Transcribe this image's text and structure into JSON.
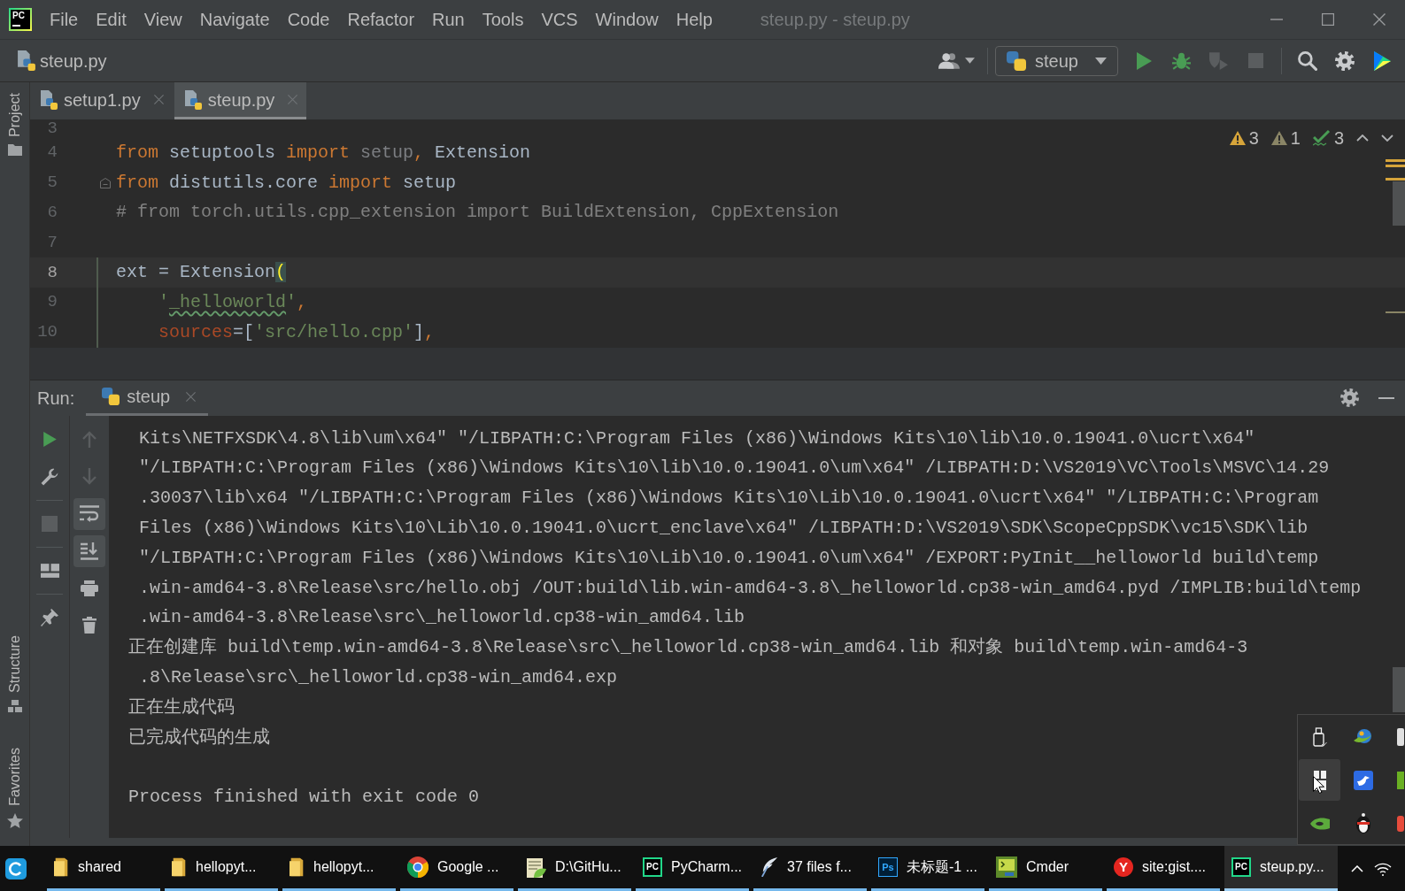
{
  "window": {
    "logo": "PC",
    "title": "steup.py - steup.py"
  },
  "menu": [
    {
      "label": "File"
    },
    {
      "label": "Edit"
    },
    {
      "label": "View"
    },
    {
      "label": "Navigate"
    },
    {
      "label": "Code"
    },
    {
      "label": "Refactor"
    },
    {
      "label": "Run"
    },
    {
      "label": "Tools"
    },
    {
      "label": "VCS"
    },
    {
      "label": "Window"
    },
    {
      "label": "Help"
    }
  ],
  "navigation_bar": {
    "breadcrumb": "steup.py",
    "run_configuration": "steup",
    "actions": [
      {
        "disabled": false
      },
      {
        "disabled": false
      },
      {
        "disabled": true
      },
      {
        "disabled": true
      }
    ]
  },
  "tool_strip": {
    "top": [
      {
        "label": "Project",
        "kind": "folder"
      }
    ],
    "bottom": [
      {
        "label": "Structure",
        "kind": "tree"
      },
      {
        "label": "Favorites",
        "kind": "star"
      }
    ]
  },
  "editor_tabs": [
    {
      "label": "setup1.py",
      "selected": false
    },
    {
      "label": "steup.py",
      "selected": true
    }
  ],
  "editor": {
    "inspections": [
      {
        "kind": "warning",
        "count": "3"
      },
      {
        "kind": "weak",
        "count": "1"
      },
      {
        "kind": "typo",
        "count": "3"
      }
    ],
    "lines": [
      {
        "number": "3",
        "current": false,
        "changed": false,
        "fold": false
      },
      {
        "number": "4",
        "current": false,
        "changed": false,
        "fold": false,
        "indented": false,
        "tokens": [
          {
            "text": "from",
            "kind": "keyword"
          },
          {
            "text": " setuptools ",
            "kind": "plain"
          },
          {
            "text": "import",
            "kind": "keyword"
          },
          {
            "text": " setup",
            "kind": "unused"
          },
          {
            "text": ",",
            "kind": "punct"
          },
          {
            "text": " Extension",
            "kind": "plain"
          }
        ]
      },
      {
        "number": "5",
        "current": false,
        "changed": false,
        "fold": true,
        "indented": false,
        "tokens": [
          {
            "text": "from",
            "kind": "keyword"
          },
          {
            "text": " distutils.core ",
            "kind": "plain"
          },
          {
            "text": "import",
            "kind": "keyword"
          },
          {
            "text": " setup",
            "kind": "plain"
          }
        ]
      },
      {
        "number": "6",
        "current": false,
        "changed": false,
        "fold": false,
        "indented": false,
        "tokens": [
          {
            "text": "# from torch.utils.cpp_extension import BuildExtension, CppExtension",
            "kind": "comment"
          }
        ]
      },
      {
        "number": "7",
        "current": false,
        "changed": false,
        "fold": false
      },
      {
        "number": "8",
        "current": true,
        "changed": true,
        "fold": false,
        "indented": false,
        "tokens": [
          {
            "text": "ext = Extension",
            "kind": "plain"
          },
          {
            "text": "(",
            "kind": "match"
          }
        ]
      },
      {
        "number": "9",
        "current": false,
        "changed": true,
        "fold": false,
        "indented": true,
        "tokens": [
          {
            "text": "'",
            "kind": "string"
          },
          {
            "text": "_helloworld",
            "kind": "typo"
          },
          {
            "text": "'",
            "kind": "string"
          },
          {
            "text": ",",
            "kind": "punct"
          }
        ]
      },
      {
        "number": "10",
        "current": false,
        "changed": true,
        "fold": false,
        "indented": true,
        "tokens": [
          {
            "text": "sources",
            "kind": "param"
          },
          {
            "text": "=[",
            "kind": "plain"
          },
          {
            "text": "'src/hello.cpp'",
            "kind": "string"
          },
          {
            "text": "]",
            "kind": "plain"
          },
          {
            "text": ",",
            "kind": "punct"
          }
        ]
      }
    ]
  },
  "run_panel": {
    "title": "Run:",
    "tabs": [
      {
        "label": "steup",
        "selected": true
      }
    ],
    "toolbar_left": [
      {
        "disabled": false
      },
      {
        "disabled": false
      },
      {
        "disabled": true
      },
      {
        "disabled": false
      },
      {
        "disabled": false
      }
    ],
    "toolbar_right": [
      {
        "disabled": true,
        "on": false
      },
      {
        "disabled": true,
        "on": false
      },
      {
        "disabled": false,
        "on": true
      },
      {
        "disabled": false,
        "on": true
      },
      {
        "disabled": false,
        "on": false
      },
      {
        "disabled": false,
        "on": false
      }
    ],
    "console": [
      {
        "text": "Kits\\NETFXSDK\\4.8\\lib\\um\\x64\" \"/LIBPATH:C:\\Program Files (x86)\\Windows Kits\\10\\lib\\10.0.19041.0\\ucrt\\x64\"",
        "kind": "output",
        "wrapped": true
      },
      {
        "text": "\"/LIBPATH:C:\\Program Files (x86)\\Windows Kits\\10\\lib\\10.0.19041.0\\um\\x64\" /LIBPATH:D:\\VS2019\\VC\\Tools\\MSVC\\14.29",
        "kind": "output",
        "wrapped": true
      },
      {
        "text": ".30037\\lib\\x64 \"/LIBPATH:C:\\Program Files (x86)\\Windows Kits\\10\\Lib\\10.0.19041.0\\ucrt\\x64\" \"/LIBPATH:C:\\Program",
        "kind": "output",
        "wrapped": true
      },
      {
        "text": "Files (x86)\\Windows Kits\\10\\Lib\\10.0.19041.0\\ucrt_enclave\\x64\" /LIBPATH:D:\\VS2019\\SDK\\ScopeCppSDK\\vc15\\SDK\\lib",
        "kind": "output",
        "wrapped": true
      },
      {
        "text": "\"/LIBPATH:C:\\Program Files (x86)\\Windows Kits\\10\\Lib\\10.0.19041.0\\um\\x64\" /EXPORT:PyInit__helloworld build\\temp",
        "kind": "output",
        "wrapped": true
      },
      {
        "text": ".win-amd64-3.8\\Release\\src/hello.obj /OUT:build\\lib.win-amd64-3.8\\_helloworld.cp38-win_amd64.pyd /IMPLIB:build\\temp",
        "kind": "output",
        "wrapped": true
      },
      {
        "text": ".win-amd64-3.8\\Release\\src\\_helloworld.cp38-win_amd64.lib",
        "kind": "output",
        "wrapped": true
      },
      {
        "text": "正在创建库 build\\temp.win-amd64-3.8\\Release\\src\\_helloworld.cp38-win_amd64.lib 和对象 build\\temp.win-amd64-3",
        "kind": "output",
        "wrapped": false
      },
      {
        "text": ".8\\Release\\src\\_helloworld.cp38-win_amd64.exp",
        "kind": "output",
        "wrapped": true
      },
      {
        "text": "正在生成代码",
        "kind": "output",
        "wrapped": false
      },
      {
        "text": "已完成代码的生成",
        "kind": "output",
        "wrapped": false
      },
      {
        "text": "Process finished with exit code 0",
        "kind": "status",
        "wrapped": false
      }
    ]
  },
  "tray_overflow": [
    {
      "hovered": false
    },
    {
      "hovered": false
    },
    {
      "hovered": false
    },
    {
      "hovered": true
    },
    {
      "hovered": false
    },
    {
      "hovered": false
    },
    {
      "hovered": false
    },
    {
      "hovered": false
    },
    {
      "hovered": false
    }
  ],
  "taskbar": [
    {
      "label": "shared",
      "kind": "folder",
      "selected": false
    },
    {
      "label": "hellopyt...",
      "kind": "folder",
      "selected": false
    },
    {
      "label": "hellopyt...",
      "kind": "folder",
      "selected": false
    },
    {
      "label": "Google ...",
      "kind": "browser",
      "selected": false
    },
    {
      "label": "D:\\GitHu...",
      "kind": "notepad",
      "selected": false
    },
    {
      "label": "PyCharm...",
      "kind": "ide",
      "logo": "PC",
      "selected": false
    },
    {
      "label": "37 files f...",
      "kind": "feather",
      "selected": false
    },
    {
      "label": "未标题-1 ...",
      "kind": "image",
      "logo": "Ps",
      "selected": false
    },
    {
      "label": "Cmder",
      "kind": "terminal",
      "selected": false
    },
    {
      "label": "site:gist....",
      "kind": "search",
      "logo": "Y",
      "selected": false
    },
    {
      "label": "steup.py...",
      "kind": "ide",
      "logo": "PC",
      "selected": true
    }
  ]
}
